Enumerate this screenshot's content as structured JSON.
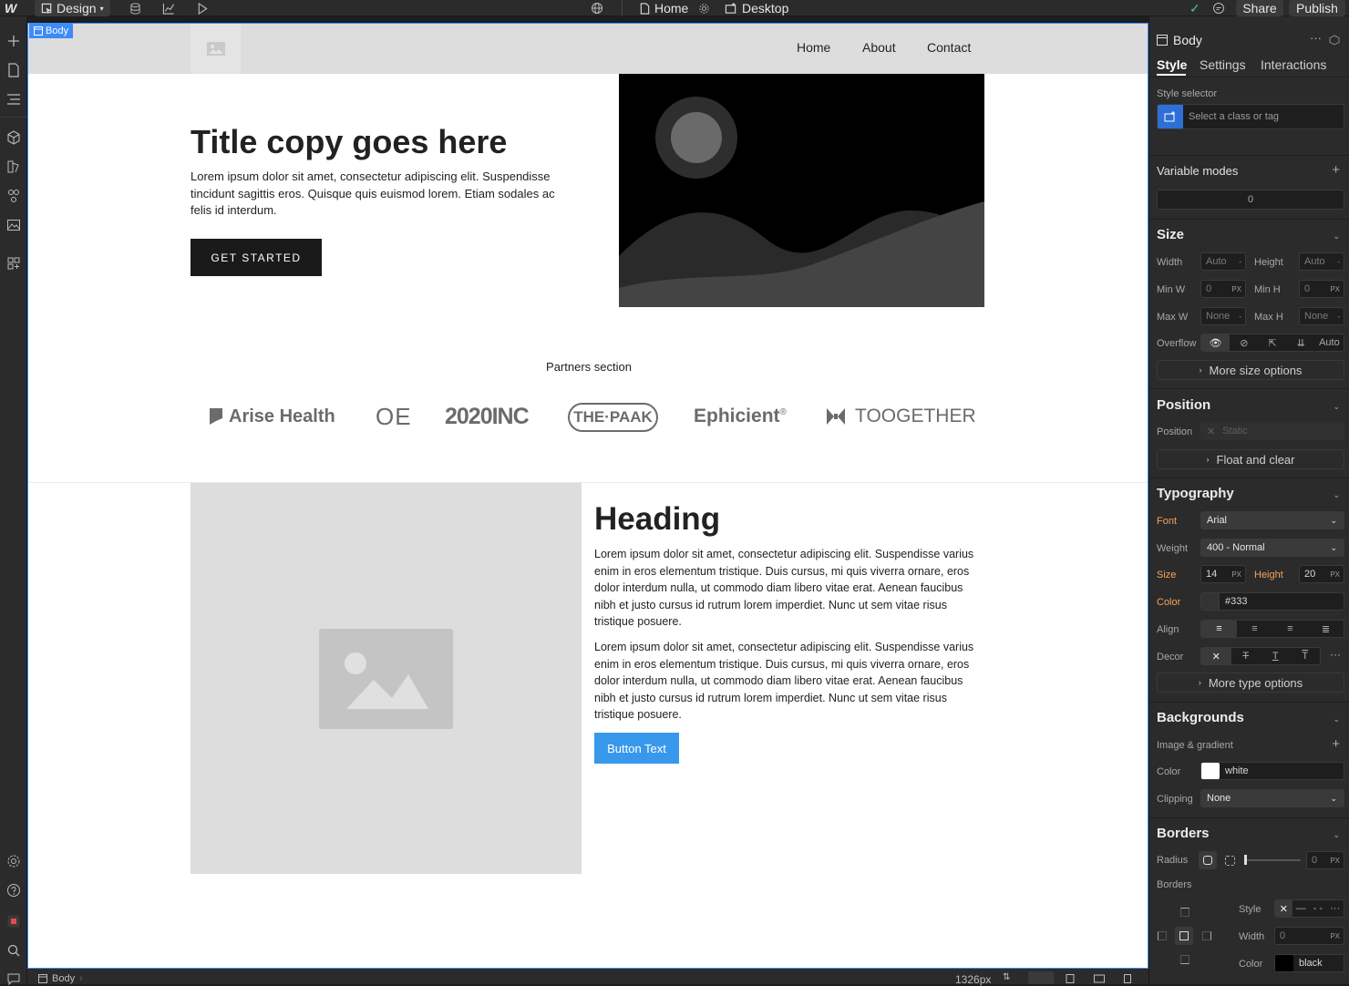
{
  "topbar": {
    "mode_label": "Design",
    "page_label": "Home",
    "breakpoint_label": "Desktop",
    "share_label": "Share",
    "publish_label": "Publish"
  },
  "canvas": {
    "selected_tag": "Body",
    "nav": {
      "links": [
        "Home",
        "About",
        "Contact"
      ]
    },
    "hero": {
      "title": "Title copy goes here",
      "text": "Lorem ipsum dolor sit amet, consectetur adipiscing elit. Suspendisse tincidunt sagittis eros. Quisque quis euismod lorem. Etiam sodales ac felis id interdum.",
      "button": "GET STARTED"
    },
    "partners": {
      "label": "Partners section",
      "logos": [
        "Arise Health",
        "OE",
        "2020INC",
        "THE·PAAK",
        "Ephicient",
        "TOOGETHER"
      ]
    },
    "feature": {
      "heading": "Heading",
      "paragraph1": "Lorem ipsum dolor sit amet, consectetur adipiscing elit. Suspendisse varius enim in eros elementum tristique. Duis cursus, mi quis viverra ornare, eros dolor interdum nulla, ut commodo diam libero vitae erat. Aenean faucibus nibh et justo cursus id rutrum lorem imperdiet. Nunc ut sem vitae risus tristique posuere.",
      "paragraph2": "Lorem ipsum dolor sit amet, consectetur adipiscing elit. Suspendisse varius enim in eros elementum tristique. Duis cursus, mi quis viverra ornare, eros dolor interdum nulla, ut commodo diam libero vitae erat. Aenean faucibus nibh et justo cursus id rutrum lorem imperdiet. Nunc ut sem vitae risus tristique posuere.",
      "button": "Button Text"
    }
  },
  "statusbar": {
    "breadcrumb": "Body",
    "width_readout": "1326px"
  },
  "panel": {
    "element": "Body",
    "tabs": [
      "Style",
      "Settings",
      "Interactions"
    ],
    "style_selector": {
      "label": "Style selector",
      "placeholder": "Select a class or tag"
    },
    "variable_modes": {
      "title": "Variable modes",
      "value": "0"
    },
    "size": {
      "title": "Size",
      "width_label": "Width",
      "width": "Auto",
      "height_label": "Height",
      "height": "Auto",
      "minw_label": "Min W",
      "minw": "0",
      "minw_unit": "PX",
      "minh_label": "Min H",
      "minh": "0",
      "minh_unit": "PX",
      "maxw_label": "Max W",
      "maxw": "None",
      "maxh_label": "Max H",
      "maxh": "None",
      "overflow_label": "Overflow",
      "overflow_auto": "Auto",
      "more": "More size options"
    },
    "position": {
      "title": "Position",
      "label": "Position",
      "value": "Static",
      "more": "Float and clear"
    },
    "typography": {
      "title": "Typography",
      "font_label": "Font",
      "font": "Arial",
      "weight_label": "Weight",
      "weight": "400 - Normal",
      "size_label": "Size",
      "size": "14",
      "size_unit": "PX",
      "height_label": "Height",
      "height": "20",
      "height_unit": "PX",
      "color_label": "Color",
      "color": "#333",
      "align_label": "Align",
      "decor_label": "Decor",
      "more": "More type options"
    },
    "backgrounds": {
      "title": "Backgrounds",
      "image_label": "Image & gradient",
      "color_label": "Color",
      "color": "white",
      "clipping_label": "Clipping",
      "clipping": "None"
    },
    "borders": {
      "title": "Borders",
      "radius_label": "Radius",
      "radius": "0",
      "radius_unit": "PX",
      "borders_label": "Borders",
      "style_label": "Style",
      "width_label": "Width",
      "width": "0",
      "width_unit": "PX",
      "color_label": "Color",
      "color": "black"
    }
  },
  "colors": {
    "accent": "#3d8bf7",
    "panel_bg": "#2b2b2b",
    "button_blue": "#3898ec"
  }
}
